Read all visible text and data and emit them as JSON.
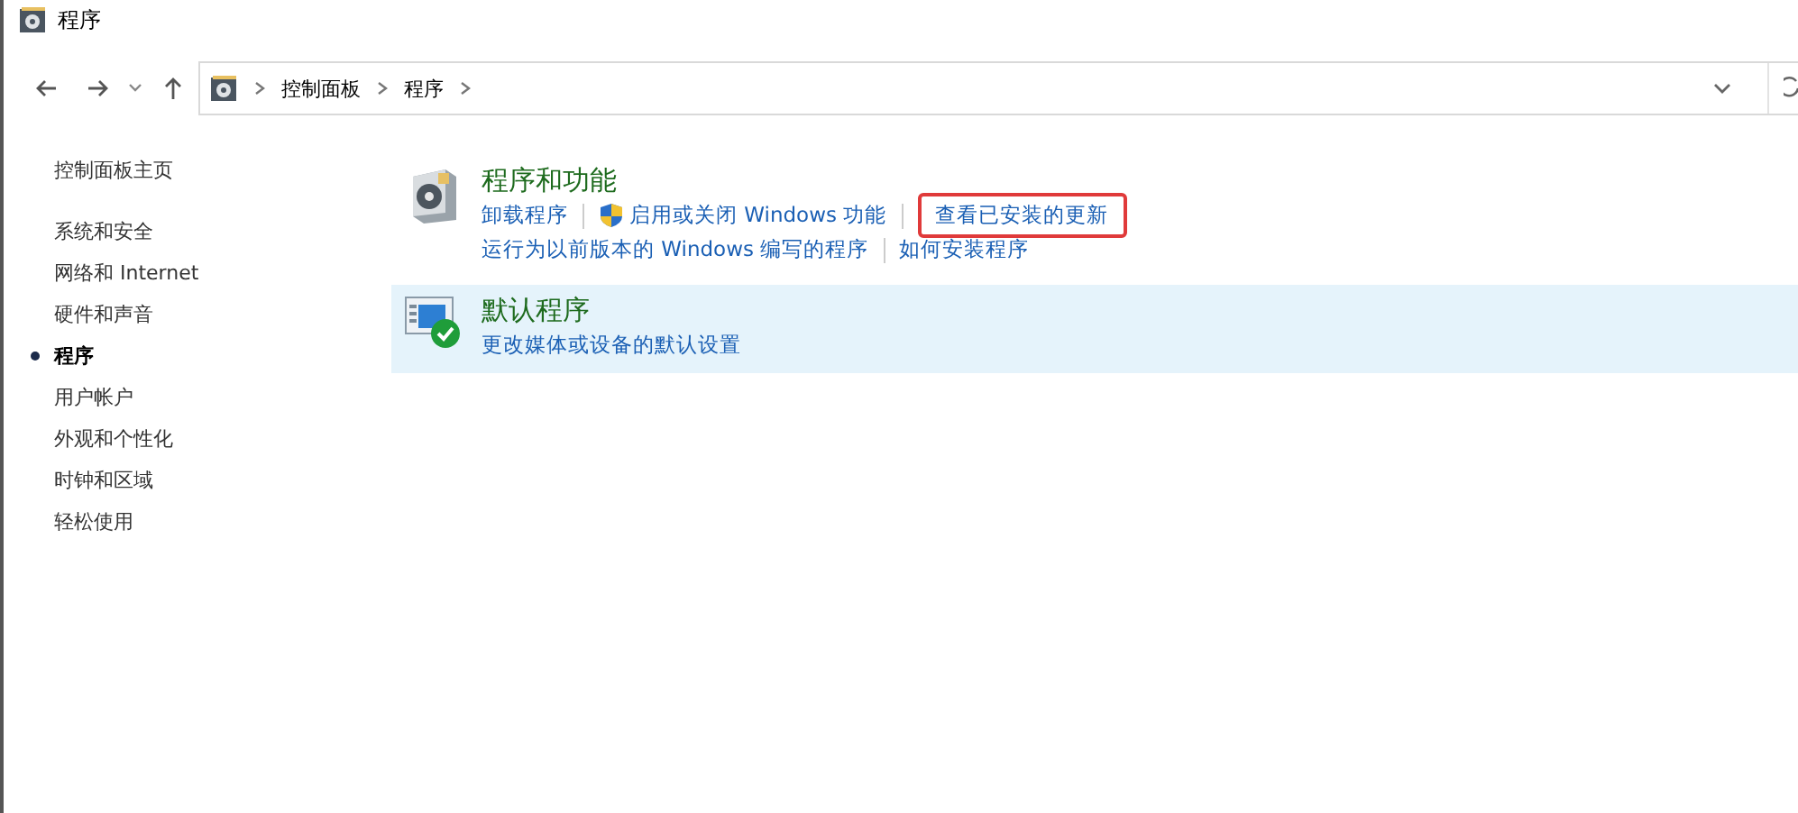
{
  "window": {
    "title": "程序"
  },
  "address_bar": {
    "crumbs": [
      "控制面板",
      "程序"
    ]
  },
  "sidebar": {
    "home": "控制面板主页",
    "items": [
      {
        "label": "系统和安全",
        "selected": false
      },
      {
        "label": "网络和 Internet",
        "selected": false
      },
      {
        "label": "硬件和声音",
        "selected": false
      },
      {
        "label": "程序",
        "selected": true
      },
      {
        "label": "用户帐户",
        "selected": false
      },
      {
        "label": "外观和个性化",
        "selected": false
      },
      {
        "label": "时钟和区域",
        "selected": false
      },
      {
        "label": "轻松使用",
        "selected": false
      }
    ]
  },
  "sections": [
    {
      "kind": "programs",
      "title": "程序和功能",
      "selected": false,
      "link_rows": [
        [
          {
            "label": "卸载程序",
            "shield": false,
            "highlighted": false
          },
          {
            "label": "启用或关闭 Windows 功能",
            "shield": true,
            "highlighted": false
          },
          {
            "label": "查看已安装的更新",
            "shield": false,
            "highlighted": true
          }
        ],
        [
          {
            "label": "运行为以前版本的 Windows 编写的程序",
            "shield": false,
            "highlighted": false
          },
          {
            "label": "如何安装程序",
            "shield": false,
            "highlighted": false
          }
        ]
      ]
    },
    {
      "kind": "defaults",
      "title": "默认程序",
      "selected": true,
      "link_rows": [
        [
          {
            "label": "更改媒体或设备的默认设置",
            "shield": false,
            "highlighted": false
          }
        ]
      ]
    }
  ]
}
